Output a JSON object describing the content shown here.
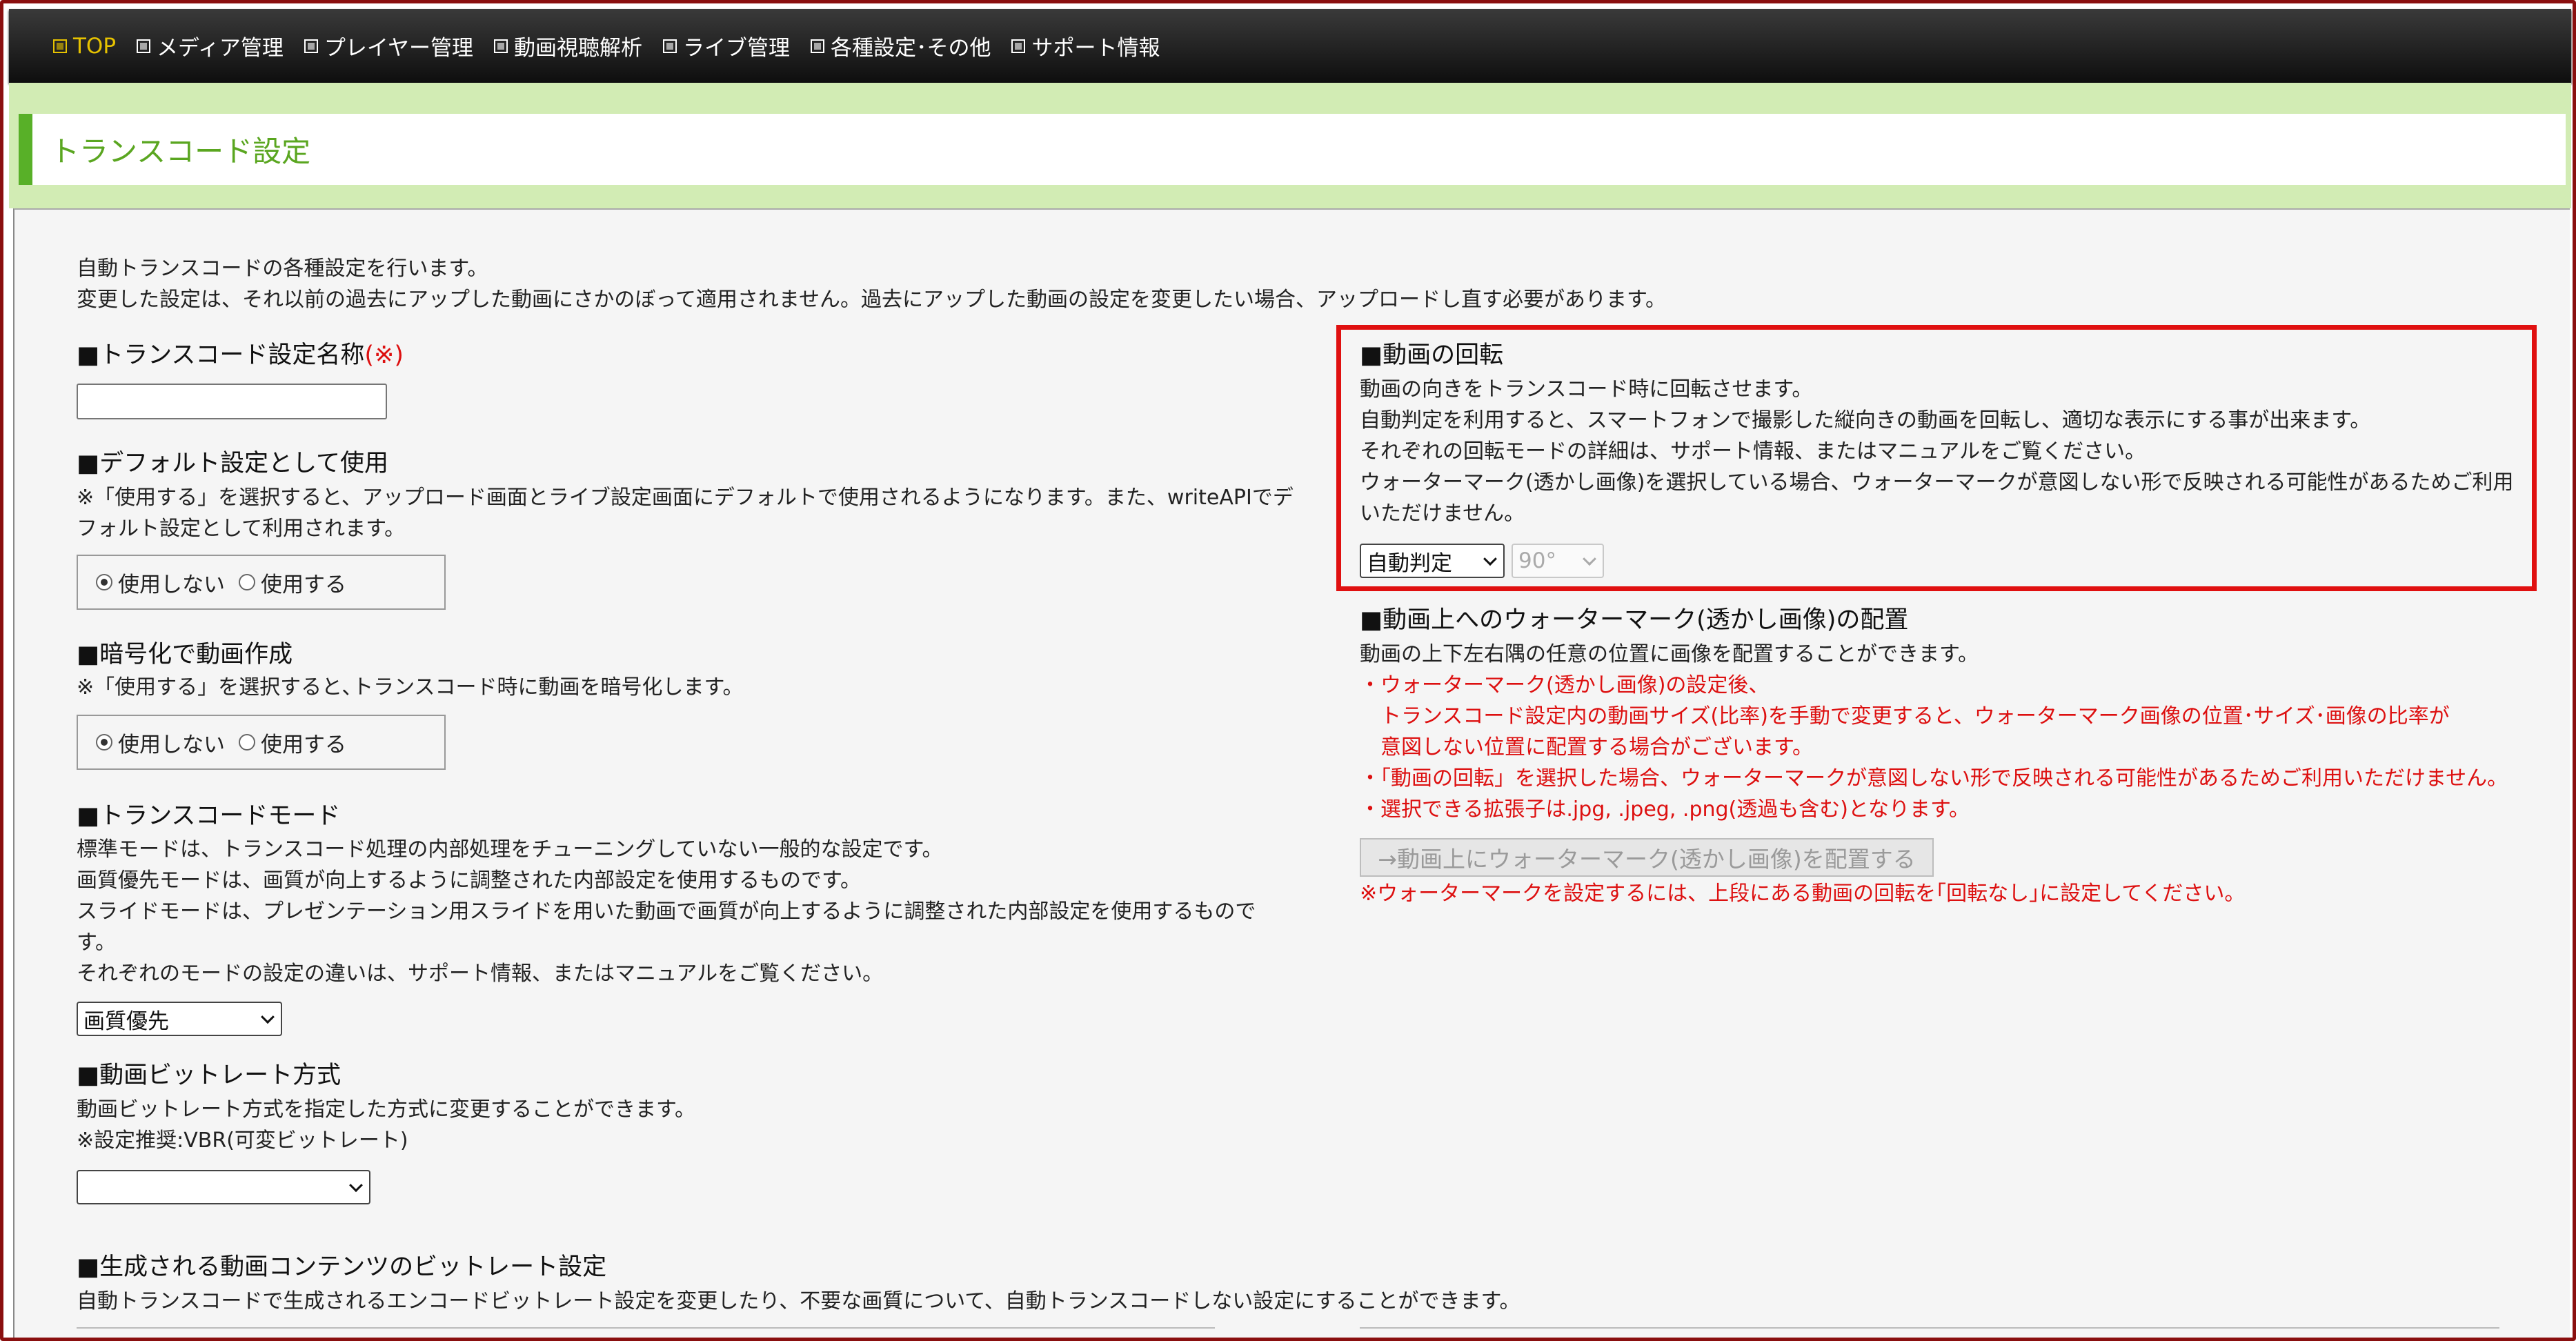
{
  "nav": [
    {
      "label": "TOP",
      "icon": "checkbox-icon",
      "active": true
    },
    {
      "label": "メディア管理",
      "icon": "checkbox-icon"
    },
    {
      "label": "プレイヤー管理",
      "icon": "checkbox-icon"
    },
    {
      "label": "動画視聴解析",
      "icon": "checkbox-icon"
    },
    {
      "label": "ライブ管理",
      "icon": "checkbox-icon"
    },
    {
      "label": "各種設定･その他",
      "icon": "checkbox-icon"
    },
    {
      "label": "サポート情報",
      "icon": "checkbox-icon"
    }
  ],
  "page_title": "トランスコード設定",
  "intro": [
    "自動トランスコードの各種設定を行います。",
    "変更した設定は、それ以前の過去にアップした動画にさかのぼって適用されません。過去にアップした動画の設定を変更したい場合、アップロードし直す必要があります。"
  ],
  "name_section": {
    "title": "■トランスコード設定名称",
    "required": "(※)",
    "value": ""
  },
  "default_section": {
    "title": "■デフォルト設定として使用",
    "desc": [
      "※「使用する」を選択すると、アップロード画面とライブ設定画面にデフォルトで使用されるようになります。また、writeAPIでデ",
      "フォルト設定として利用されます。"
    ],
    "options": [
      "使用しない",
      "使用する"
    ],
    "selected": 0
  },
  "encrypt_section": {
    "title": "■暗号化で動画作成",
    "desc": [
      "※「使用する」を選択すると､トランスコード時に動画を暗号化します。"
    ],
    "options": [
      "使用しない",
      "使用する"
    ],
    "selected": 0
  },
  "mode_section": {
    "title": "■トランスコードモード",
    "desc": [
      "標準モードは、トランスコード処理の内部処理をチューニングしていない一般的な設定です。",
      "画質優先モードは、画質が向上するように調整された内部設定を使用するものです。",
      "スライドモードは、プレゼンテーション用スライドを用いた動画で画質が向上するように調整された内部設定を使用するもので",
      "す。",
      "それぞれのモードの設定の違いは、サポート情報、またはマニュアルをご覧ください。"
    ],
    "selected": "画質優先"
  },
  "bitrate_mode_section": {
    "title": "■動画ビットレート方式",
    "desc": [
      "動画ビットレート方式を指定した方式に変更することができます。",
      "※設定推奨:VBR(可変ビットレート)"
    ],
    "selected": ""
  },
  "generated_section": {
    "title": "■生成される動画コンテンツのビットレート設定",
    "desc": [
      "自動トランスコードで生成されるエンコードビットレート設定を変更したり、不要な画質について、自動トランスコードしない設定にすることができます。"
    ]
  },
  "rotation_section": {
    "title": "■動画の回転",
    "desc": [
      "動画の向きをトランスコード時に回転させます。",
      "自動判定を利用すると、スマートフォンで撮影した縦向きの動画を回転し、適切な表示にする事が出来ます。",
      "それぞれの回転モードの詳細は、サポート情報、またはマニュアルをご覧ください。",
      "ウォーターマーク(透かし画像)を選択している場合、ウォーターマークが意図しない形で反映される可能性があるためご利用",
      "いただけません。"
    ],
    "mode_selected": "自動判定",
    "angle_selected": "90°",
    "highlight_color": "#e01010"
  },
  "watermark_section": {
    "title": "■動画上へのウォーターマーク(透かし画像)の配置",
    "desc": [
      "動画の上下左右隅の任意の位置に画像を配置することができます。"
    ],
    "warnings": [
      "・ウォーターマーク(透かし画像)の設定後、",
      "　トランスコード設定内の動画サイズ(比率)を手動で変更すると、ウォーターマーク画像の位置･サイズ･画像の比率が",
      "　意図しない位置に配置する場合がございます。",
      "・「動画の回転」を選択した場合、ウォーターマークが意図しない形で反映される可能性があるためご利用いただけません。",
      "・選択できる拡張子は.jpg, .jpeg, .png(透過も含む)となります。"
    ],
    "button_label": "→動画上にウォーターマーク(透かし画像)を配置する",
    "note": "※ウォーターマークを設定するには、上段にある動画の回転を｢回転なし｣に設定してください。"
  },
  "colors": {
    "nav_bg": "#111111",
    "nav_active": "#e6c200",
    "title_green": "#5aa620",
    "band_green": "#d2ecb4",
    "warning_red": "#dd1010"
  }
}
